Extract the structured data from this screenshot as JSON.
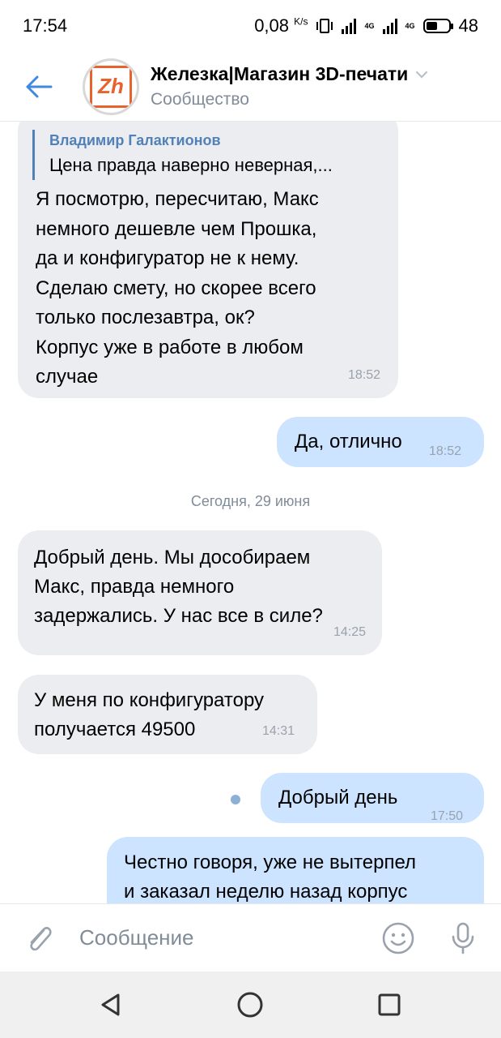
{
  "status_bar": {
    "time": "17:54",
    "speed_value": "0,08",
    "speed_unit": "K/s",
    "network1": "4G",
    "network2": "4G",
    "battery": "48"
  },
  "header": {
    "title": "Железка|Магазин 3D-печати",
    "subtitle": "Сообщество",
    "avatar_text": "Zh"
  },
  "messages": {
    "m1": {
      "quote_author": "Владимир Галактионов",
      "quote_text": "Цена правда наверно неверная,...",
      "lines": [
        "Я посмотрю, пересчитаю, Макс",
        "немного дешевле чем Прошка,",
        "да и конфигуратор не к нему.",
        "Сделаю смету, но скорее всего",
        "только послезавтра, ок?",
        "Корпус уже в работе в любом",
        "случае"
      ],
      "time": "18:52"
    },
    "m2": {
      "text": "Да, отлично",
      "time": "18:52"
    },
    "day_separator": "Сегодня, 29 июня",
    "m3": {
      "lines": [
        "Добрый день. Мы дособираем",
        "Макс, правда немного",
        "задержались. У нас все в силе?"
      ],
      "time": "14:25"
    },
    "m4": {
      "lines": [
        "У меня по конфигуратору",
        "получается 49500"
      ],
      "time": "14:31"
    },
    "m5": {
      "text": "Добрый день",
      "time": "17:50"
    },
    "m6": {
      "lines": [
        "Честно говоря, уже не вытерпел",
        "и заказал неделю назад корпус"
      ]
    }
  },
  "composer": {
    "placeholder": "Сообщение"
  },
  "colors": {
    "incoming_bubble": "#ebedf0",
    "outgoing_bubble": "#cce4ff",
    "accent": "#5181b8",
    "icon_gray": "#99a2ad"
  }
}
